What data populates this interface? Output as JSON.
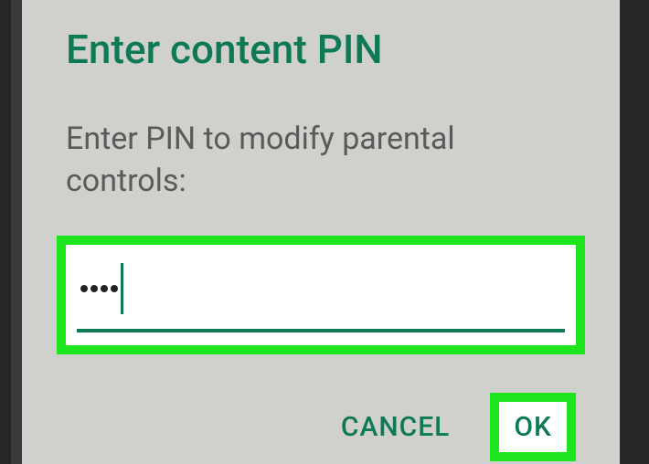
{
  "dialog": {
    "title": "Enter content PIN",
    "prompt": "Enter PIN to modify parental controls:",
    "pin_masked_length": 4,
    "buttons": {
      "cancel": "CANCEL",
      "ok": "OK"
    }
  },
  "colors": {
    "accent": "#0d7a55",
    "highlight": "#1ee61e",
    "dialog_bg": "#d0d0cd"
  }
}
